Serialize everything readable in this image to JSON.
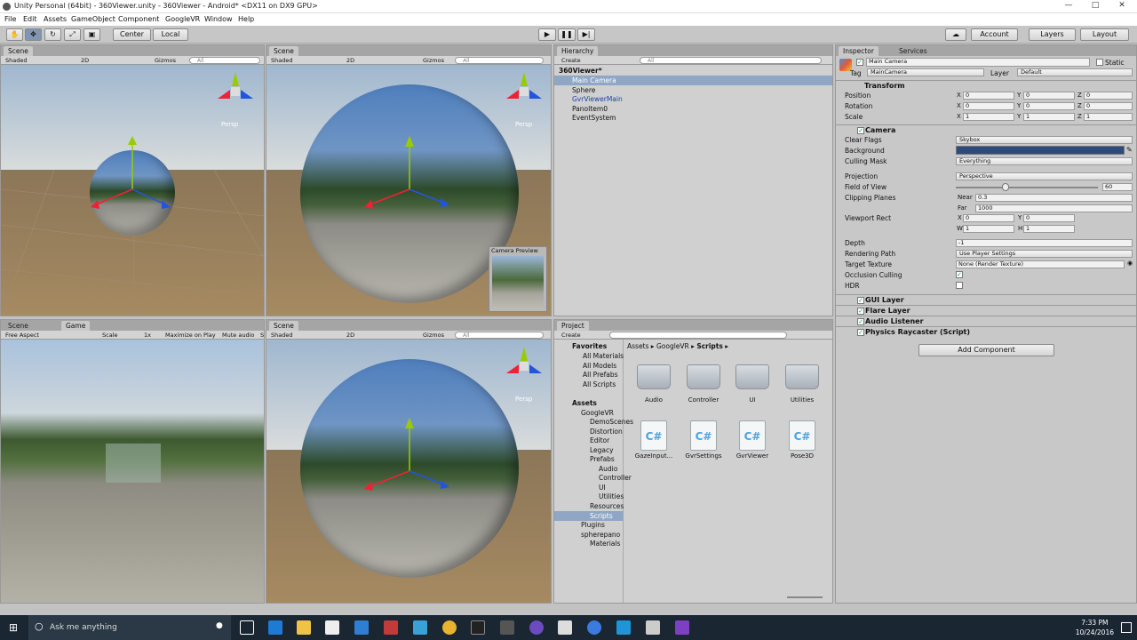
{
  "window": {
    "title": "Unity Personal (64bit) - 360Viewer.unity - 360Viewer - Android* <DX11 on DX9 GPU>"
  },
  "menu": [
    "File",
    "Edit",
    "Assets",
    "GameObject",
    "Component",
    "GoogleVR",
    "Window",
    "Help"
  ],
  "toolbar": {
    "pivot": "Center",
    "space": "Local",
    "account": "Account",
    "layers": "Layers",
    "layout": "Layout"
  },
  "scene_tl": {
    "tab": "Scene",
    "shading": "Shaded",
    "mode2d": "2D",
    "gizmos": "Gizmos",
    "search": "All",
    "persp": "Persp"
  },
  "scene_tr": {
    "tab": "Scene",
    "shading": "Shaded",
    "mode2d": "2D",
    "gizmos": "Gizmos",
    "search": "All",
    "persp": "Persp",
    "camera_preview": "Camera Preview"
  },
  "game": {
    "tab_scene": "Scene",
    "tab_game": "Game",
    "aspect": "Free Aspect",
    "scale_label": "Scale",
    "scale_value": "1x",
    "maximize": "Maximize on Play",
    "mute": "Mute audio",
    "stats": "S"
  },
  "scene_br": {
    "tab": "Scene",
    "shading": "Shaded",
    "mode2d": "2D",
    "gizmos": "Gizmos",
    "search": "All",
    "persp": "Persp"
  },
  "hierarchy": {
    "tab": "Hierarchy",
    "create": "Create",
    "search": "All",
    "scene": "360Viewer*",
    "items": [
      "Main Camera",
      "Sphere",
      "GvrViewerMain",
      "PanoItem0",
      "EventSystem"
    ]
  },
  "project": {
    "tab": "Project",
    "create": "Create",
    "favorites_label": "Favorites",
    "favorites": [
      "All Materials",
      "All Models",
      "All Prefabs",
      "All Scripts"
    ],
    "assets_label": "Assets",
    "tree": [
      "GoogleVR",
      "DemoScenes",
      "Distortion",
      "Editor",
      "Legacy",
      "Prefabs",
      "Audio",
      "Controller",
      "UI",
      "Utilities",
      "Resources",
      "Scripts",
      "Plugins",
      "spherepano",
      "Materials"
    ],
    "breadcrumb": [
      "Assets",
      "GoogleVR",
      "Scripts"
    ],
    "folders": [
      "Audio",
      "Controller",
      "UI",
      "Utilities"
    ],
    "scripts": [
      "GazeInput...",
      "GvrSettings",
      "GvrViewer",
      "Pose3D"
    ]
  },
  "inspector": {
    "tab": "Inspector",
    "tab2": "Services",
    "name": "Main Camera",
    "static": "Static",
    "tag_label": "Tag",
    "tag": "MainCamera",
    "layer_label": "Layer",
    "layer": "Default",
    "transform": {
      "title": "Transform",
      "position": [
        "0",
        "0",
        "0"
      ],
      "rotation": [
        "0",
        "0",
        "0"
      ],
      "scale": [
        "1",
        "1",
        "1"
      ]
    },
    "labels": {
      "position": "Position",
      "rotation": "Rotation",
      "scale": "Scale"
    },
    "camera": {
      "title": "Camera",
      "clear_flags_label": "Clear Flags",
      "clear_flags": "Skybox",
      "background_label": "Background",
      "culling_mask_label": "Culling Mask",
      "culling_mask": "Everything",
      "projection_label": "Projection",
      "projection": "Perspective",
      "fov_label": "Field of View",
      "fov": "60",
      "clipping_label": "Clipping Planes",
      "near_label": "Near",
      "near": "0.3",
      "far_label": "Far",
      "far": "1000",
      "viewport_label": "Viewport Rect",
      "vx": "0",
      "vy": "0",
      "vw": "1",
      "vh": "1",
      "depth_label": "Depth",
      "depth": "-1",
      "rendering_label": "Rendering Path",
      "rendering": "Use Player Settings",
      "target_label": "Target Texture",
      "target": "None (Render Texture)",
      "occlusion_label": "Occlusion Culling",
      "hdr_label": "HDR"
    },
    "components": [
      "GUI Layer",
      "Flare Layer",
      "Audio Listener",
      "Physics Raycaster (Script)"
    ],
    "add_component": "Add Component"
  },
  "taskbar": {
    "search": "Ask me anything",
    "time": "7:33 PM",
    "date": "10/24/2016"
  },
  "colors": {
    "background_swatch": "#2e4a7a"
  }
}
